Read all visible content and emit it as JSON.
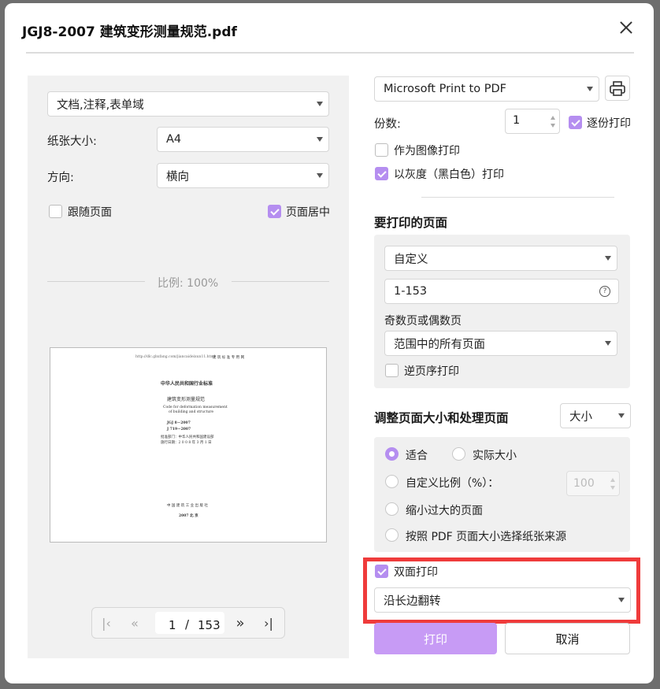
{
  "dialog": {
    "title": "JGJ8-2007 建筑变形测量规范.pdf"
  },
  "left": {
    "content_select": "文档,注释,表单域",
    "paper_size_label": "纸张大小:",
    "paper_size_value": "A4",
    "orientation_label": "方向:",
    "orientation_value": "横向",
    "follow_page_label": "跟随页面",
    "center_page_label": "页面居中",
    "scale_text": "比例: 100%",
    "preview": {
      "url_line": "http://dlc.gbxfang.com/jiancaideixun11.html",
      "stamp": "建 筑 标 准 专 用 网",
      "line1": "中华人民共和国行业标准",
      "line2": "建筑变形测量规范",
      "line3": "Code for deformation measurement",
      "line4": "of building and structure",
      "line5": "JGJ 8－2007",
      "line6": "J 719－2007",
      "line7": "批准部门：中华人民共和国建设部",
      "line8": "施行日期：2 0 0 8 年 3 月 1 日",
      "line9": "中 国 建 筑 工 业 出 版 社",
      "line10": "2007  北  京"
    },
    "nav": {
      "current_page": "1",
      "separator": "/",
      "total_pages": "153"
    }
  },
  "right": {
    "printer": "Microsoft Print to PDF",
    "copies_label": "份数:",
    "copies_value": "1",
    "collate_label": "逐份打印",
    "print_as_image_label": "作为图像打印",
    "grayscale_label": "以灰度（黑白色）打印",
    "pages_heading": "要打印的页面",
    "pages_mode": "自定义",
    "pages_range": "1-153",
    "odd_even_label": "奇数页或偶数页",
    "odd_even_value": "范围中的所有页面",
    "reverse_label": "逆页序打印",
    "resize_heading": "调整页面大小和处理页面",
    "resize_mode": "大小",
    "fit_label": "适合",
    "actual_size_label": "实际大小",
    "custom_scale_label": "自定义比例（%）：",
    "custom_scale_value": "100",
    "shrink_label": "缩小过大的页面",
    "paper_source_label": "按照 PDF 页面大小选择纸张来源",
    "duplex_label": "双面打印",
    "duplex_value": "沿长边翻转",
    "print_button": "打印",
    "cancel_button": "取消"
  },
  "colors": {
    "accent": "#b58ef0",
    "print_button": "#c79bf5",
    "highlight": "#ef3b3b"
  }
}
